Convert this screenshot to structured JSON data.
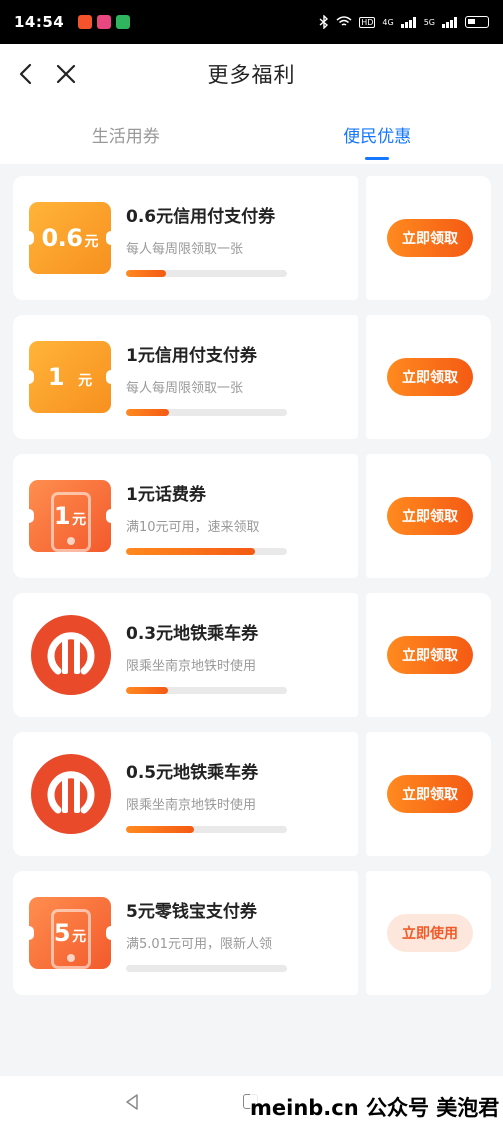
{
  "status_bar": {
    "time": "14:54",
    "network_4g": "4G",
    "network_5g": "5G",
    "hd": "HD"
  },
  "header": {
    "title": "更多福利"
  },
  "tabs": [
    {
      "label": "生活用券",
      "active": false
    },
    {
      "label": "便民优惠",
      "active": true
    }
  ],
  "coupons": [
    {
      "title": "0.6元信用付支付券",
      "desc": "每人每周限领取一张",
      "progress": 0.25,
      "button": "立即领取",
      "thumb_amount": "0.6",
      "thumb_unit": "元",
      "thumb_type": "ticket"
    },
    {
      "title": "1元信用付支付券",
      "desc": "每人每周限领取一张",
      "progress": 0.27,
      "button": "立即领取",
      "thumb_amount": "1",
      "thumb_unit": "元",
      "thumb_type": "ticket"
    },
    {
      "title": "1元话费券",
      "desc": "满10元可用，速来领取",
      "progress": 0.8,
      "button": "立即领取",
      "thumb_amount": "1",
      "thumb_unit": "元",
      "thumb_type": "phone"
    },
    {
      "title": "0.3元地铁乘车券",
      "desc": "限乘坐南京地铁时使用",
      "progress": 0.26,
      "button": "立即领取",
      "thumb_type": "metro"
    },
    {
      "title": "0.5元地铁乘车券",
      "desc": "限乘坐南京地铁时使用",
      "progress": 0.42,
      "button": "立即领取",
      "thumb_type": "metro"
    },
    {
      "title": "5元零钱宝支付券",
      "desc": "满5.01元可用，限新人领",
      "progress": 0.0,
      "button": "立即使用",
      "thumb_amount": "5",
      "thumb_unit": "元",
      "thumb_type": "phone"
    }
  ],
  "watermark": "meinb.cn 公众号 美泡君",
  "colors": {
    "accent": "#1677ff",
    "button_orange": "#f45a14",
    "metro_red": "#e84a2a"
  }
}
